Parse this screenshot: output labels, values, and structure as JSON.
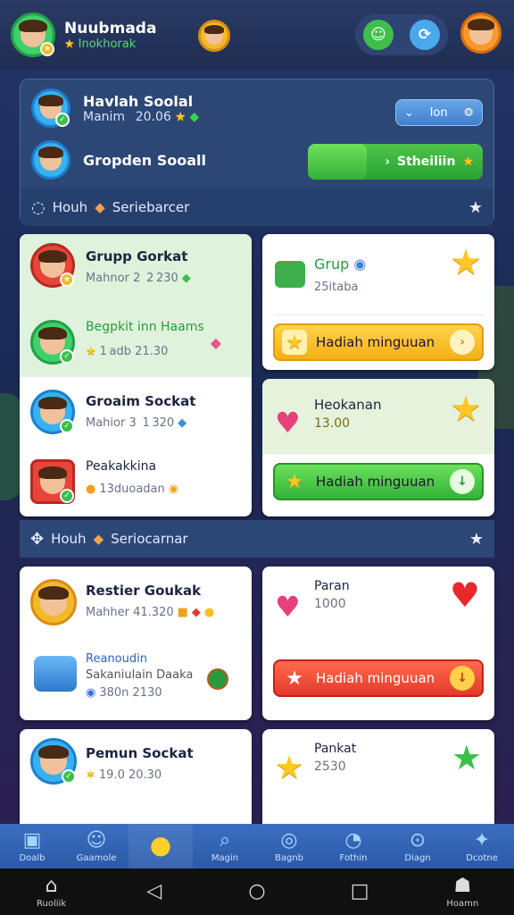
{
  "header": {
    "user_name": "Nuubmada",
    "user_sub": "Inokhorak",
    "icons": [
      "avatar-icon",
      "chat-bubble-icon",
      "refresh-icon"
    ]
  },
  "panel": {
    "row1_title": "Havlah Soolal",
    "row1_sub": "Manim   20.06",
    "pill_label": "Ion",
    "row2_title": "Gropden Sooall",
    "row2_button": "Stheiliin"
  },
  "section1": {
    "left": "Houh",
    "right": "Seriebarcer"
  },
  "section2": {
    "left": "Houh",
    "right": "Seriocarnar"
  },
  "left_cards": [
    {
      "title": "Grupp Gorkat",
      "sub": "Mahnor 2  2 230"
    },
    {
      "title": "Begpkit inn Haams",
      "sub": "1 adb 21.30"
    },
    {
      "title": "Groaim Sockat",
      "sub": "Mahior 3  1 320"
    },
    {
      "title": "Peakakkina",
      "sub": "13duoadan"
    },
    {
      "title": "Restier Goukak",
      "sub": "Mahher 41.320"
    },
    {
      "title": "Reanoudin",
      "sub": "Sakaniulain Daaka",
      "sub2": "380n 2130"
    },
    {
      "title": "Pemun Sockat",
      "sub": "19.0 20.30"
    }
  ],
  "right_cards": [
    {
      "title": "Grup",
      "sub": "25itaba",
      "button": "Hadiah minguuan"
    },
    {
      "title": "Heokanan",
      "value": "13.00",
      "button": "Hadiah minguuan"
    },
    {
      "title": "Paran",
      "value": "1000",
      "button": "Hadiah minguuan"
    },
    {
      "title": "Pankat",
      "value": "2530"
    }
  ],
  "tabbar": [
    {
      "label": "Doalb",
      "icon": "clipboard-icon"
    },
    {
      "label": "Gaamole",
      "icon": "people-icon"
    },
    {
      "label": "",
      "icon": "bell-icon"
    },
    {
      "label": "Magin",
      "icon": "search-icon"
    },
    {
      "label": "Bagnb",
      "icon": "target-icon"
    },
    {
      "label": "Fothin",
      "icon": "clock-icon"
    },
    {
      "label": "Diagn",
      "icon": "settings-icon"
    },
    {
      "label": "Dcotne",
      "icon": "bird-icon"
    }
  ],
  "navbar": {
    "home_label": "Ruoliik",
    "profile_label": "Hoamn"
  },
  "colors": {
    "accent_blue": "#2c4675",
    "reward_yellow": "#f4b018",
    "reward_green": "#33b23a",
    "reward_red": "#e23a2c"
  }
}
